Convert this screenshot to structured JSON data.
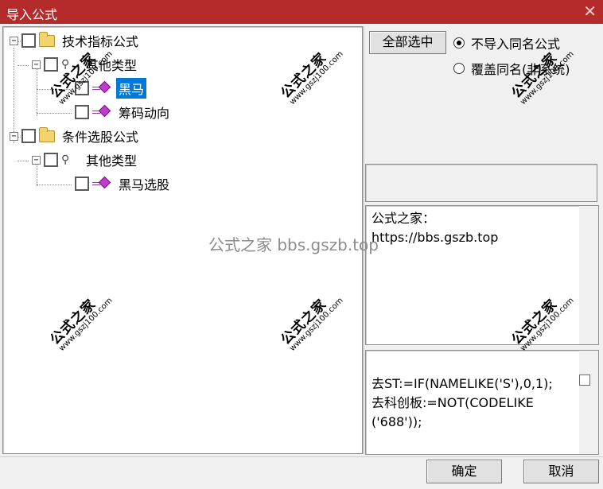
{
  "window": {
    "title": "导入公式",
    "close_glyph": "✕"
  },
  "tree": {
    "nodes": [
      {
        "label": "技术指标公式"
      },
      {
        "label": "其他类型"
      },
      {
        "label": "黑马"
      },
      {
        "label": "筹码动向"
      },
      {
        "label": "条件选股公式"
      },
      {
        "label": "其他类型"
      },
      {
        "label": "黑马选股"
      }
    ],
    "expanded_glyph": "−",
    "selected_color": "#0078d7"
  },
  "options": {
    "select_all_label": "全部选中",
    "radio_options": [
      {
        "label": "不导入同名公式",
        "checked": true
      },
      {
        "label": "覆盖同名(非系统)",
        "checked": false
      }
    ]
  },
  "description": {
    "text": "公式之家：\nhttps://bbs.gszb.top"
  },
  "code": {
    "text": "去ST:=IF(NAMELIKE('S'),0,1);\n去科创板:=NOT(CODELIKE\n('688'));"
  },
  "footer": {
    "ok_label": "确定",
    "cancel_label": "取消"
  },
  "watermark": {
    "main": "公式之家",
    "sub": "www.gszj100.com",
    "center": "公式之家 bbs.gszb.top"
  },
  "colors": {
    "title_bar": "#b52b2b",
    "selection": "#0078d7",
    "gem": "#c23bd0",
    "folder": "#f3d36b"
  },
  "icons": [
    "close-icon",
    "folder-icon",
    "key-icon",
    "gem-icon",
    "radio-icon",
    "checkbox-icon",
    "tree-expander-icon"
  ]
}
